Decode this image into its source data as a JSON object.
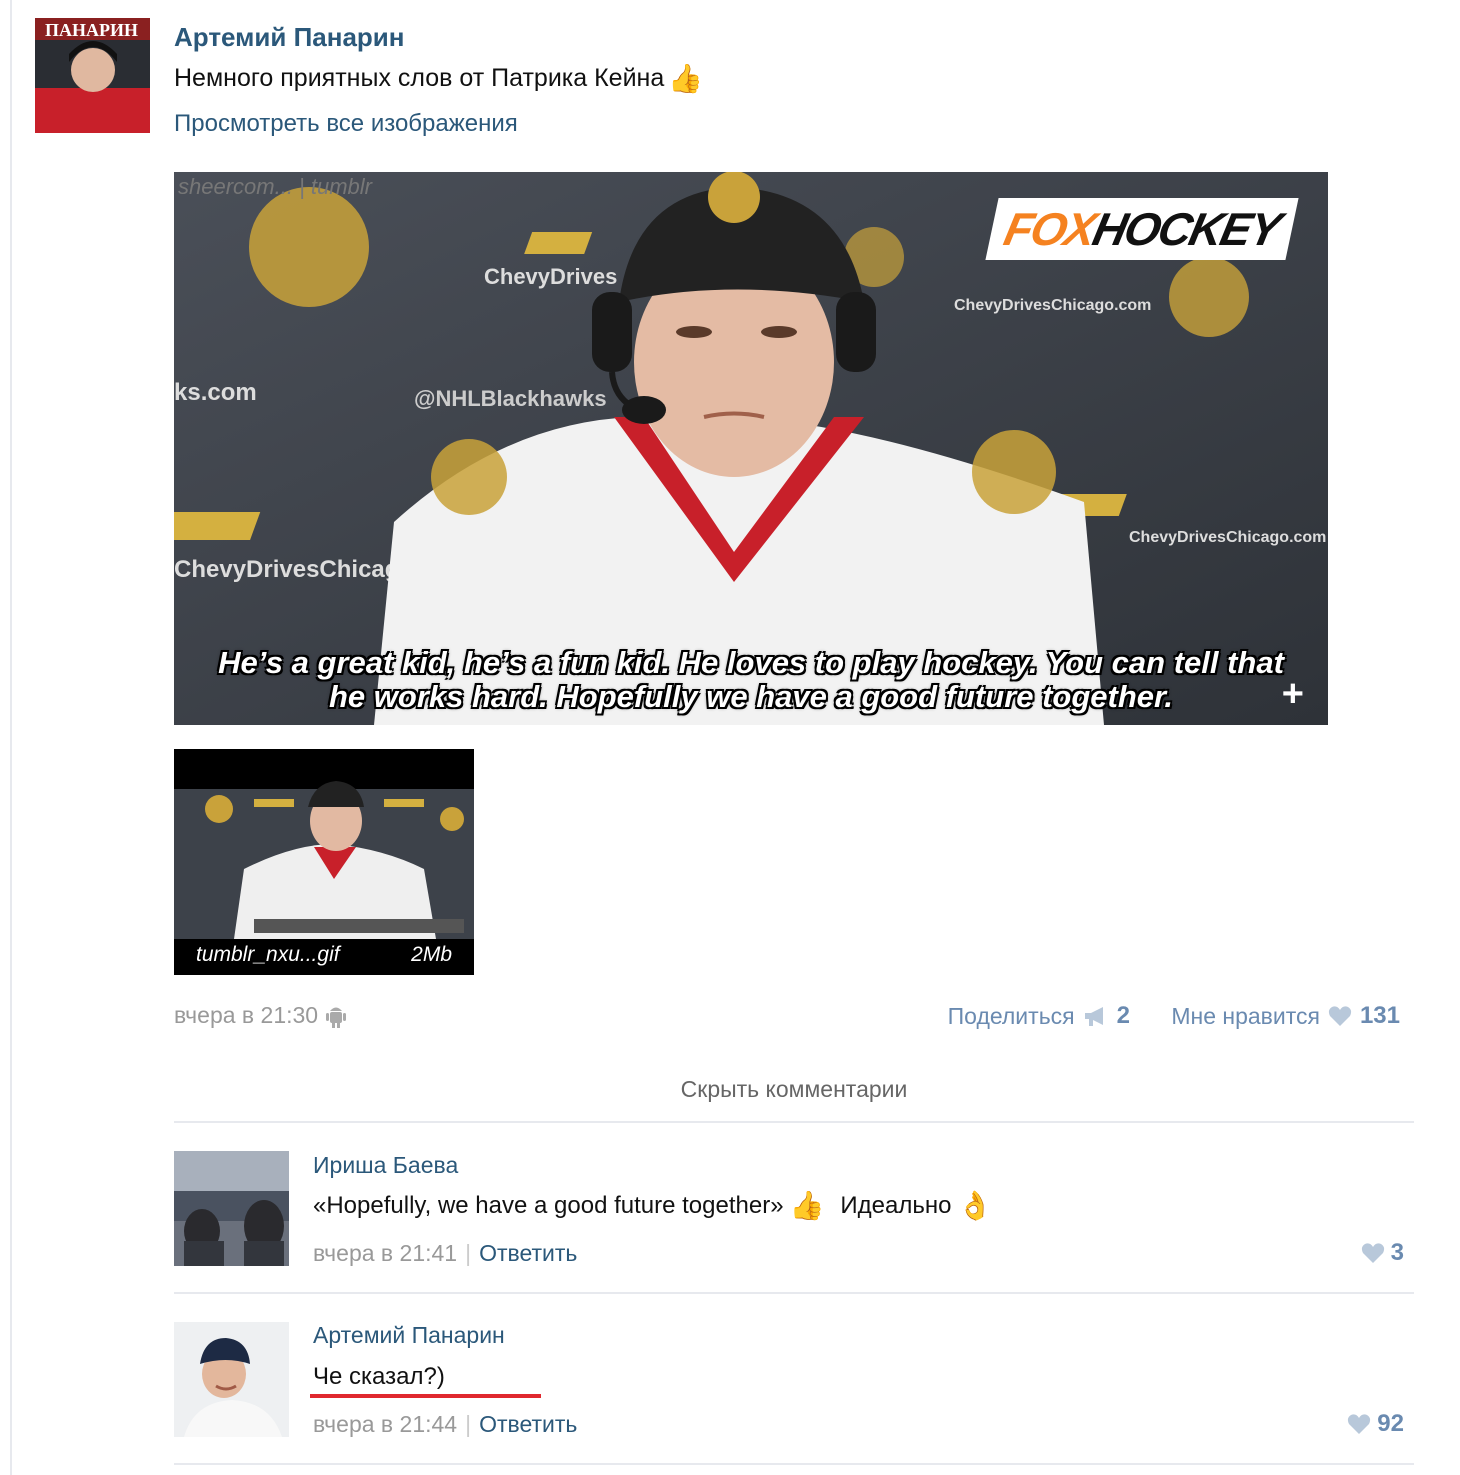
{
  "post": {
    "author": "Артемий Панарин",
    "text": "Немного приятных слов от Патрика Кейна",
    "text_emoji": "👍",
    "link": "Просмотреть все изображения",
    "image": {
      "watermark": "sheercom... | tumblr",
      "logo_part1": "FOX",
      "logo_part2": "HOCKEY",
      "subtitle_line1": "He’s a great kid, he’s a fun kid. He loves to play hockey. You can tell that",
      "subtitle_line2": "he works hard. Hopefully we have a good future together.",
      "expand_icon": "+"
    },
    "attachment": {
      "filename": "tumblr_nxu...gif",
      "size": "2Mb"
    },
    "date": "вчера в 21:30",
    "device_icon": "android-icon",
    "share_label": "Поделиться",
    "share_count": "2",
    "like_label": "Мне нравится",
    "like_count": "131"
  },
  "comments_toggle": "Скрыть комментарии",
  "comments": [
    {
      "name": "Ириша Баева",
      "text": "«Hopefully, we have a good future together»",
      "emoji1": "👍",
      "text2": "Идеально",
      "emoji2": "👌",
      "date": "вчера в 21:41",
      "separator": "|",
      "reply": "Ответить",
      "likes": "3"
    },
    {
      "name": "Артемий Панарин",
      "text": "Че сказал?)",
      "date": "вчера в 21:44",
      "separator": "|",
      "reply": "Ответить",
      "likes": "92"
    }
  ],
  "colors": {
    "link": "#2b587a",
    "meta": "#999999",
    "accent_like": "#6a8ab0",
    "underline": "#e0282e"
  }
}
